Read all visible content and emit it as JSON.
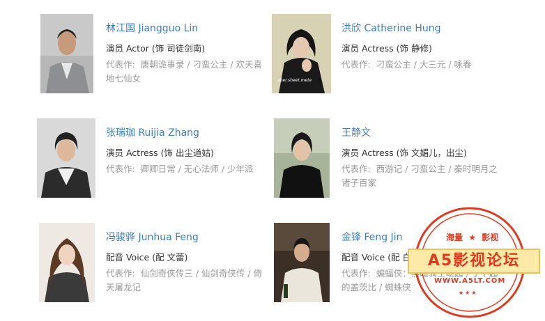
{
  "cast": [
    {
      "name": "林江国 Jiangguo Lin",
      "role": "演员 Actor (饰 司徒剑南)",
      "works_label": "代表作:",
      "works_line1": "唐朝诡事录 / 刁蛮公主 / 欢天喜",
      "works_line2": "地七仙女"
    },
    {
      "name": "洪欣 Catherine Hung",
      "role": "演员 Actress (饰 静修)",
      "works_label": "代表作:",
      "works_line1": "刁蛮公主 / 大三元 / 咏春",
      "works_line2": "",
      "photo_caption": "aber.sheet.mete"
    },
    {
      "name": "张瑞珈 Ruijia Zhang",
      "role": "演员 Actress (饰 出尘道姑)",
      "works_label": "代表作:",
      "works_line1": "卿卿日常 / 无心法师 / 少年派",
      "works_line2": ""
    },
    {
      "name": "王静文",
      "role": "演员 Actress (饰 文媚儿，出尘)",
      "works_label": "代表作:",
      "works_line1": "西游记 / 刁蛮公主 / 秦时明月之",
      "works_line2": "诸子百家"
    },
    {
      "name": "冯骏骅 Junhua Feng",
      "role": "配音 Voice (配 文蕾)",
      "works_label": "代表作:",
      "works_line1": "仙剑奇侠传三 / 仙剑奇侠传 / 倚",
      "works_line2": "天屠龙记"
    },
    {
      "name": "金锋 Feng Jin",
      "role": "配音 Voice (配 白云飞)",
      "works_label": "代表作:",
      "works_line1": "蝙蝠侠：黑暗骑士崛起 / 了不起",
      "works_line2": "的盖茨比 / 蜘蛛侠"
    }
  ],
  "watermark": {
    "top_left": "海量",
    "top_right": "影视",
    "brand": "A5影视论坛",
    "url": "WWW.A5LT.COM",
    "accent_color": "#e03a1e"
  }
}
